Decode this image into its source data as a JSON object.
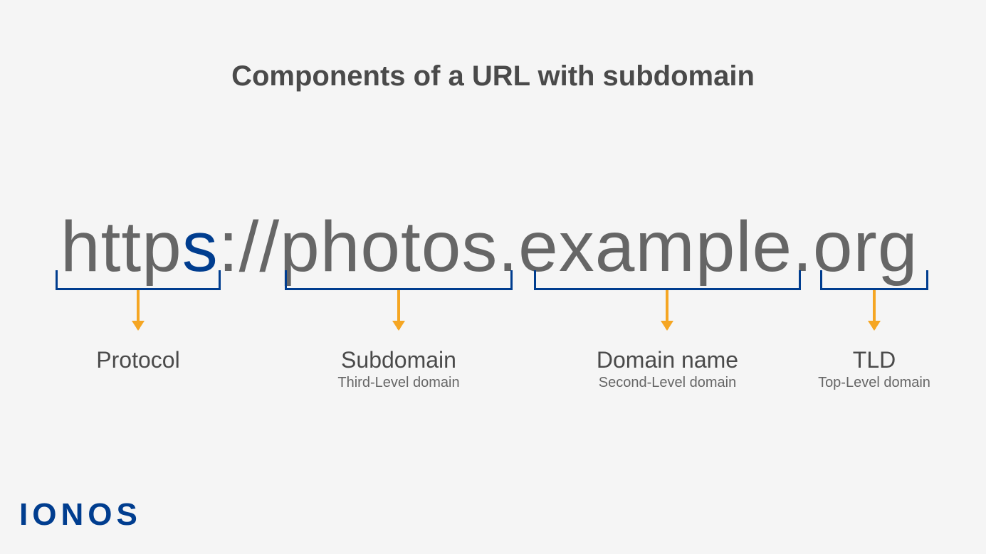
{
  "title": "Components of a URL with subdomain",
  "url": {
    "part1": "http",
    "part2": "s",
    "part3": "://photos.example.org"
  },
  "components": [
    {
      "label": "Protocol",
      "sublabel": ""
    },
    {
      "label": "Subdomain",
      "sublabel": "Third-Level domain"
    },
    {
      "label": "Domain name",
      "sublabel": "Second-Level domain"
    },
    {
      "label": "TLD",
      "sublabel": "Top-Level domain"
    }
  ],
  "logo": "IONOS",
  "colors": {
    "brand": "#003d8f",
    "arrow": "#f5a623",
    "text": "#4a4a4a",
    "bg": "#f5f5f5"
  }
}
